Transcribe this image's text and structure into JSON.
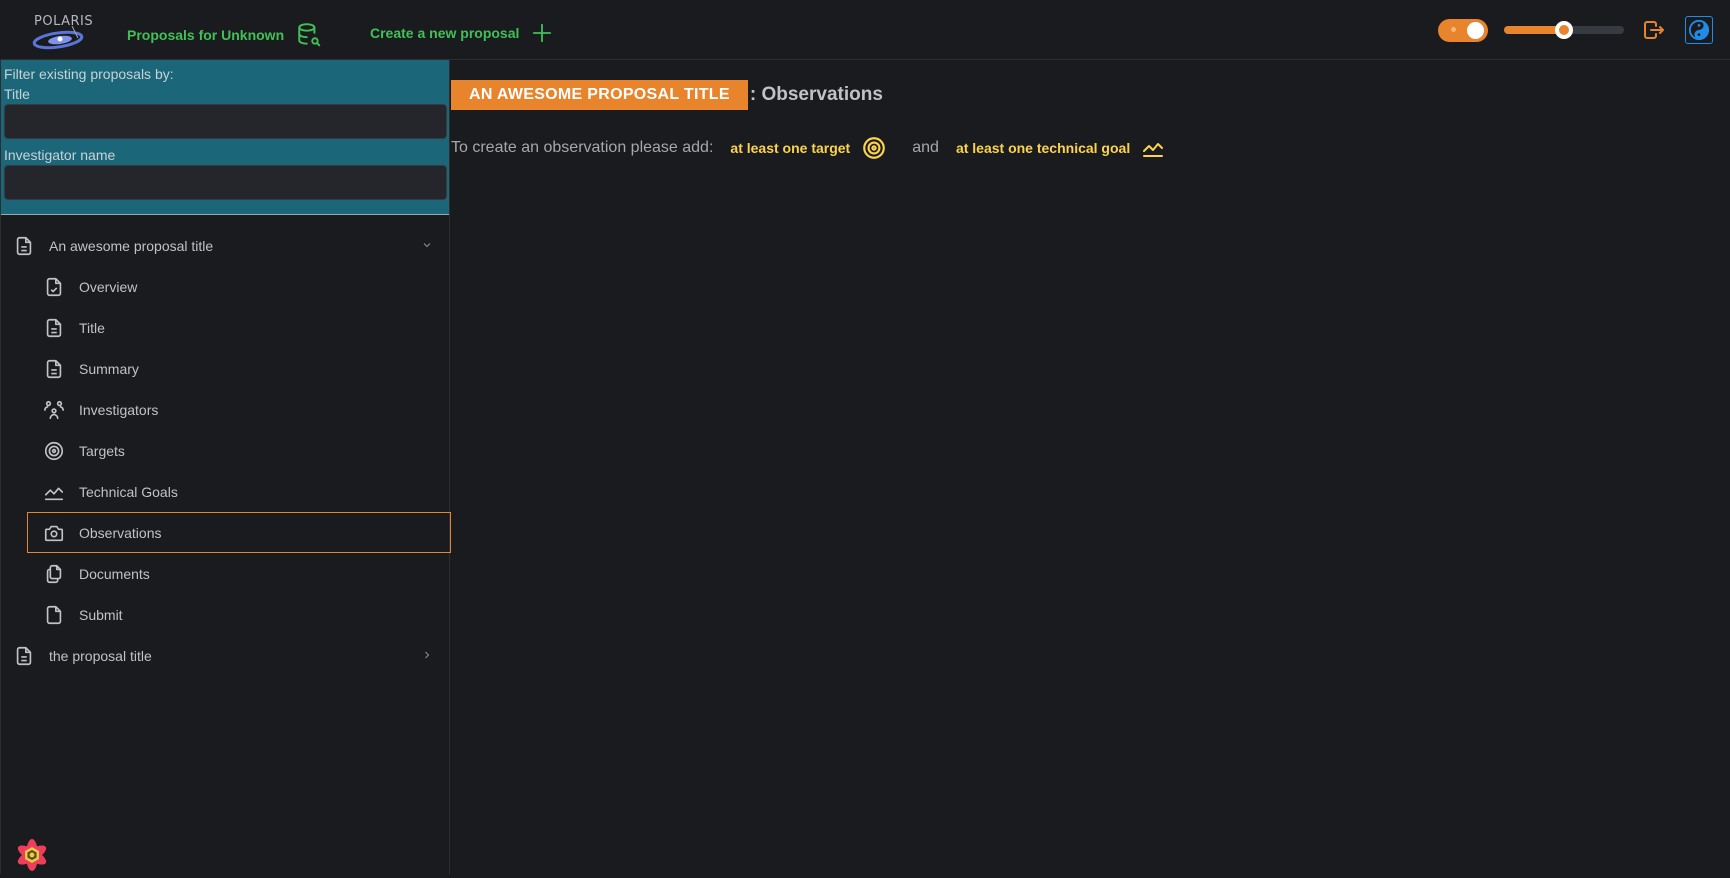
{
  "header": {
    "logo_text": "POLARIS",
    "proposals_link": "Proposals for Unknown",
    "proposals_icon": "database-search-icon",
    "create_link": "Create a new proposal",
    "create_icon": "plus-icon",
    "theme_toggle": {
      "state": "on",
      "icon": "sun-icon"
    },
    "slider": {
      "value_percent": 50
    },
    "logout_icon": "logout-icon",
    "theme_icon": "yin-yang-icon"
  },
  "sidebar": {
    "filter": {
      "heading": "Filter existing proposals by:",
      "title_label": "Title",
      "title_value": "",
      "investigator_label": "Investigator name",
      "investigator_value": ""
    },
    "proposals": [
      {
        "label": "An awesome proposal title",
        "icon": "file-text-icon",
        "expanded": true,
        "children": [
          {
            "label": "Overview",
            "icon": "file-check-icon"
          },
          {
            "label": "Title",
            "icon": "file-text-icon"
          },
          {
            "label": "Summary",
            "icon": "file-text-icon"
          },
          {
            "label": "Investigators",
            "icon": "users-group-icon"
          },
          {
            "label": "Targets",
            "icon": "target-icon"
          },
          {
            "label": "Technical Goals",
            "icon": "chart-line-icon"
          },
          {
            "label": "Observations",
            "icon": "camera-icon",
            "active": true
          },
          {
            "label": "Documents",
            "icon": "files-icon"
          },
          {
            "label": "Submit",
            "icon": "file-icon"
          }
        ]
      },
      {
        "label": "the proposal title",
        "icon": "file-text-icon",
        "expanded": false
      }
    ]
  },
  "main": {
    "proposal_title": "AN AWESOME PROPOSAL TITLE",
    "page_suffix": ": Observations",
    "requirements": {
      "prefix": "To create an observation please add:",
      "target_link": "at least one target",
      "conjunction": "and",
      "goal_link": "at least one technical goal"
    }
  },
  "colors": {
    "accent": "#e8842c",
    "link_green": "#40c057",
    "filter_bg": "#1b6779",
    "requirement_yellow": "#fcd34d",
    "background": "#1a1b1e",
    "theme_blue": "#228be6"
  }
}
